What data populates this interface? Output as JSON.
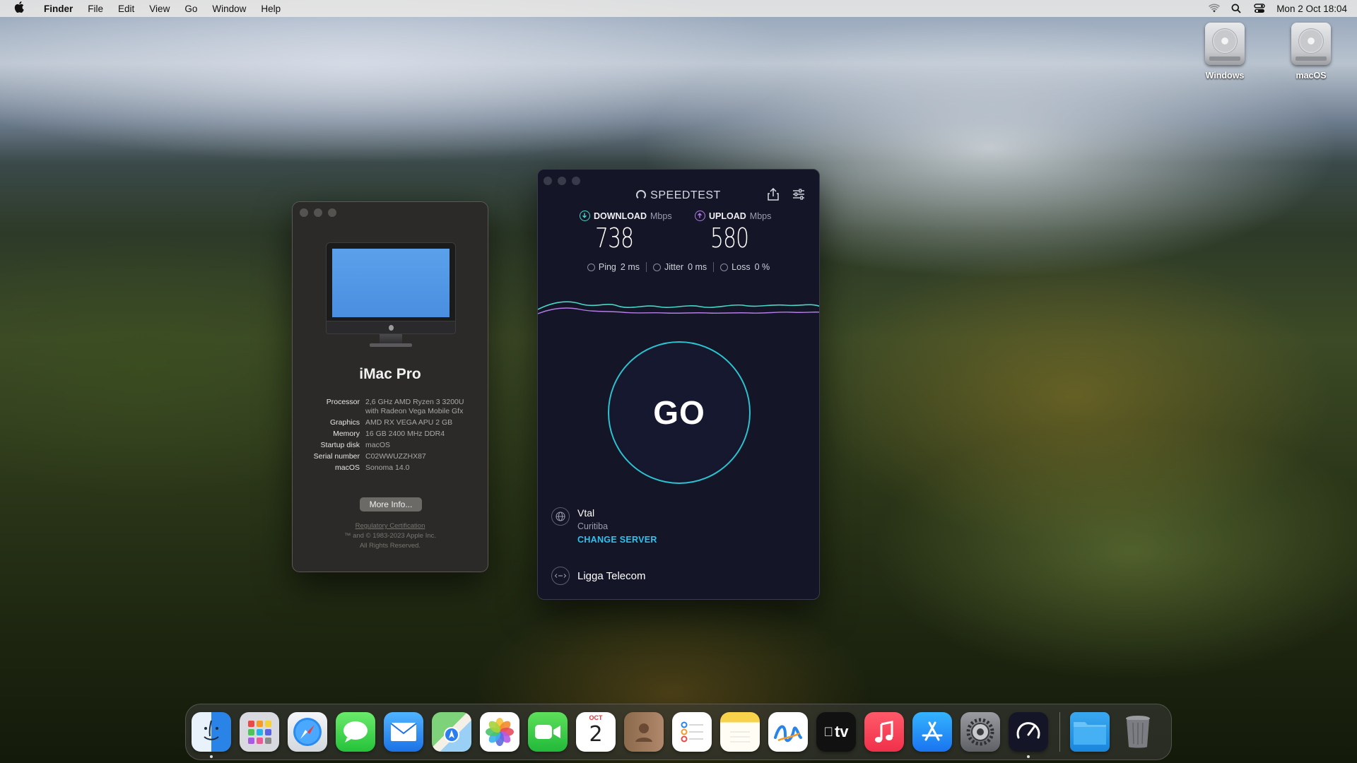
{
  "menubar": {
    "app_name": "Finder",
    "menus": [
      "File",
      "Edit",
      "View",
      "Go",
      "Window",
      "Help"
    ],
    "status_icons": [
      "wifi-icon",
      "search-icon",
      "control-center-icon"
    ],
    "clock": "Mon 2 Oct  18:04"
  },
  "desktop": {
    "drives": [
      {
        "label": "Windows",
        "icon": "hard-drive-icon"
      },
      {
        "label": "macOS",
        "icon": "hard-drive-icon"
      }
    ]
  },
  "about_mac": {
    "model": "iMac Pro",
    "specs": [
      {
        "key": "Processor",
        "value": "2,6 GHz AMD Ryzen 3 3200U with Radeon Vega Mobile Gfx"
      },
      {
        "key": "Graphics",
        "value": "AMD RX VEGA APU 2 GB"
      },
      {
        "key": "Memory",
        "value": "16 GB 2400 MHz DDR4"
      },
      {
        "key": "Startup disk",
        "value": "macOS"
      },
      {
        "key": "Serial number",
        "value": "C02WWUZZHX87"
      },
      {
        "key": "macOS",
        "value": "Sonoma 14.0"
      }
    ],
    "more_info_label": "More Info...",
    "regulatory_link": "Regulatory Certification",
    "copyright_line1": "™ and © 1983-2023 Apple Inc.",
    "copyright_line2": "All Rights Reserved."
  },
  "speedtest": {
    "title": "SPEEDTEST",
    "download": {
      "label": "DOWNLOAD",
      "unit": "Mbps",
      "value": "738",
      "color": "#45d8c6"
    },
    "upload": {
      "label": "UPLOAD",
      "unit": "Mbps",
      "value": "580",
      "color": "#b57de8"
    },
    "ping": {
      "label": "Ping",
      "value": "2 ms"
    },
    "jitter": {
      "label": "Jitter",
      "value": "0 ms"
    },
    "loss": {
      "label": "Loss",
      "value": "0 %"
    },
    "go_label": "GO",
    "server": {
      "name": "Vtal",
      "city": "Curitiba",
      "change_label": "CHANGE SERVER"
    },
    "isp": "Ligga Telecom",
    "accent": "#2ac3cf"
  },
  "dock": {
    "apps": [
      {
        "name": "Finder",
        "icon": "finder-icon",
        "running": true
      },
      {
        "name": "Launchpad",
        "icon": "launchpad-icon",
        "running": false
      },
      {
        "name": "Safari",
        "icon": "safari-icon",
        "running": false
      },
      {
        "name": "Messages",
        "icon": "messages-icon",
        "running": false
      },
      {
        "name": "Mail",
        "icon": "mail-icon",
        "running": false
      },
      {
        "name": "Maps",
        "icon": "maps-icon",
        "running": false
      },
      {
        "name": "Photos",
        "icon": "photos-icon",
        "running": false
      },
      {
        "name": "FaceTime",
        "icon": "facetime-icon",
        "running": false
      },
      {
        "name": "Calendar",
        "icon": "calendar-icon",
        "running": false,
        "month": "OCT",
        "day": "2"
      },
      {
        "name": "Contacts",
        "icon": "contacts-icon",
        "running": false
      },
      {
        "name": "Reminders",
        "icon": "reminders-icon",
        "running": false
      },
      {
        "name": "Notes",
        "icon": "notes-icon",
        "running": false
      },
      {
        "name": "Freeform",
        "icon": "freeform-icon",
        "running": false
      },
      {
        "name": "TV",
        "icon": "tv-icon",
        "running": false,
        "text": "tv"
      },
      {
        "name": "Music",
        "icon": "music-icon",
        "running": false
      },
      {
        "name": "App Store",
        "icon": "app-store-icon",
        "running": false
      },
      {
        "name": "System Settings",
        "icon": "system-settings-icon",
        "running": false
      },
      {
        "name": "Speedtest",
        "icon": "speedtest-icon",
        "running": true
      }
    ],
    "folder": {
      "name": "Downloads",
      "icon": "folder-icon"
    },
    "trash": {
      "name": "Trash",
      "icon": "trash-icon"
    }
  }
}
